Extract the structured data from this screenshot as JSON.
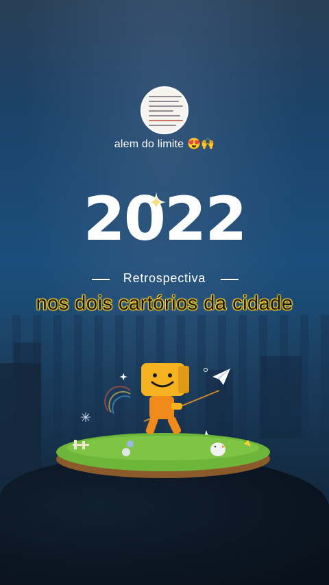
{
  "profile": {
    "username": "alem do limite",
    "emoji": "😍🙌"
  },
  "title": {
    "year": "2022",
    "subtitle": "Retrospectiva"
  },
  "caption": "nos dois cartórios da cidade",
  "colors": {
    "caption_glow": "#f7d12d",
    "background": "#1b4e7c",
    "character": "#f5b320"
  },
  "icons": {
    "sparkle": "sparkle-icon",
    "paper_plane": "paper-plane-icon",
    "character": "smiley-box-character"
  }
}
